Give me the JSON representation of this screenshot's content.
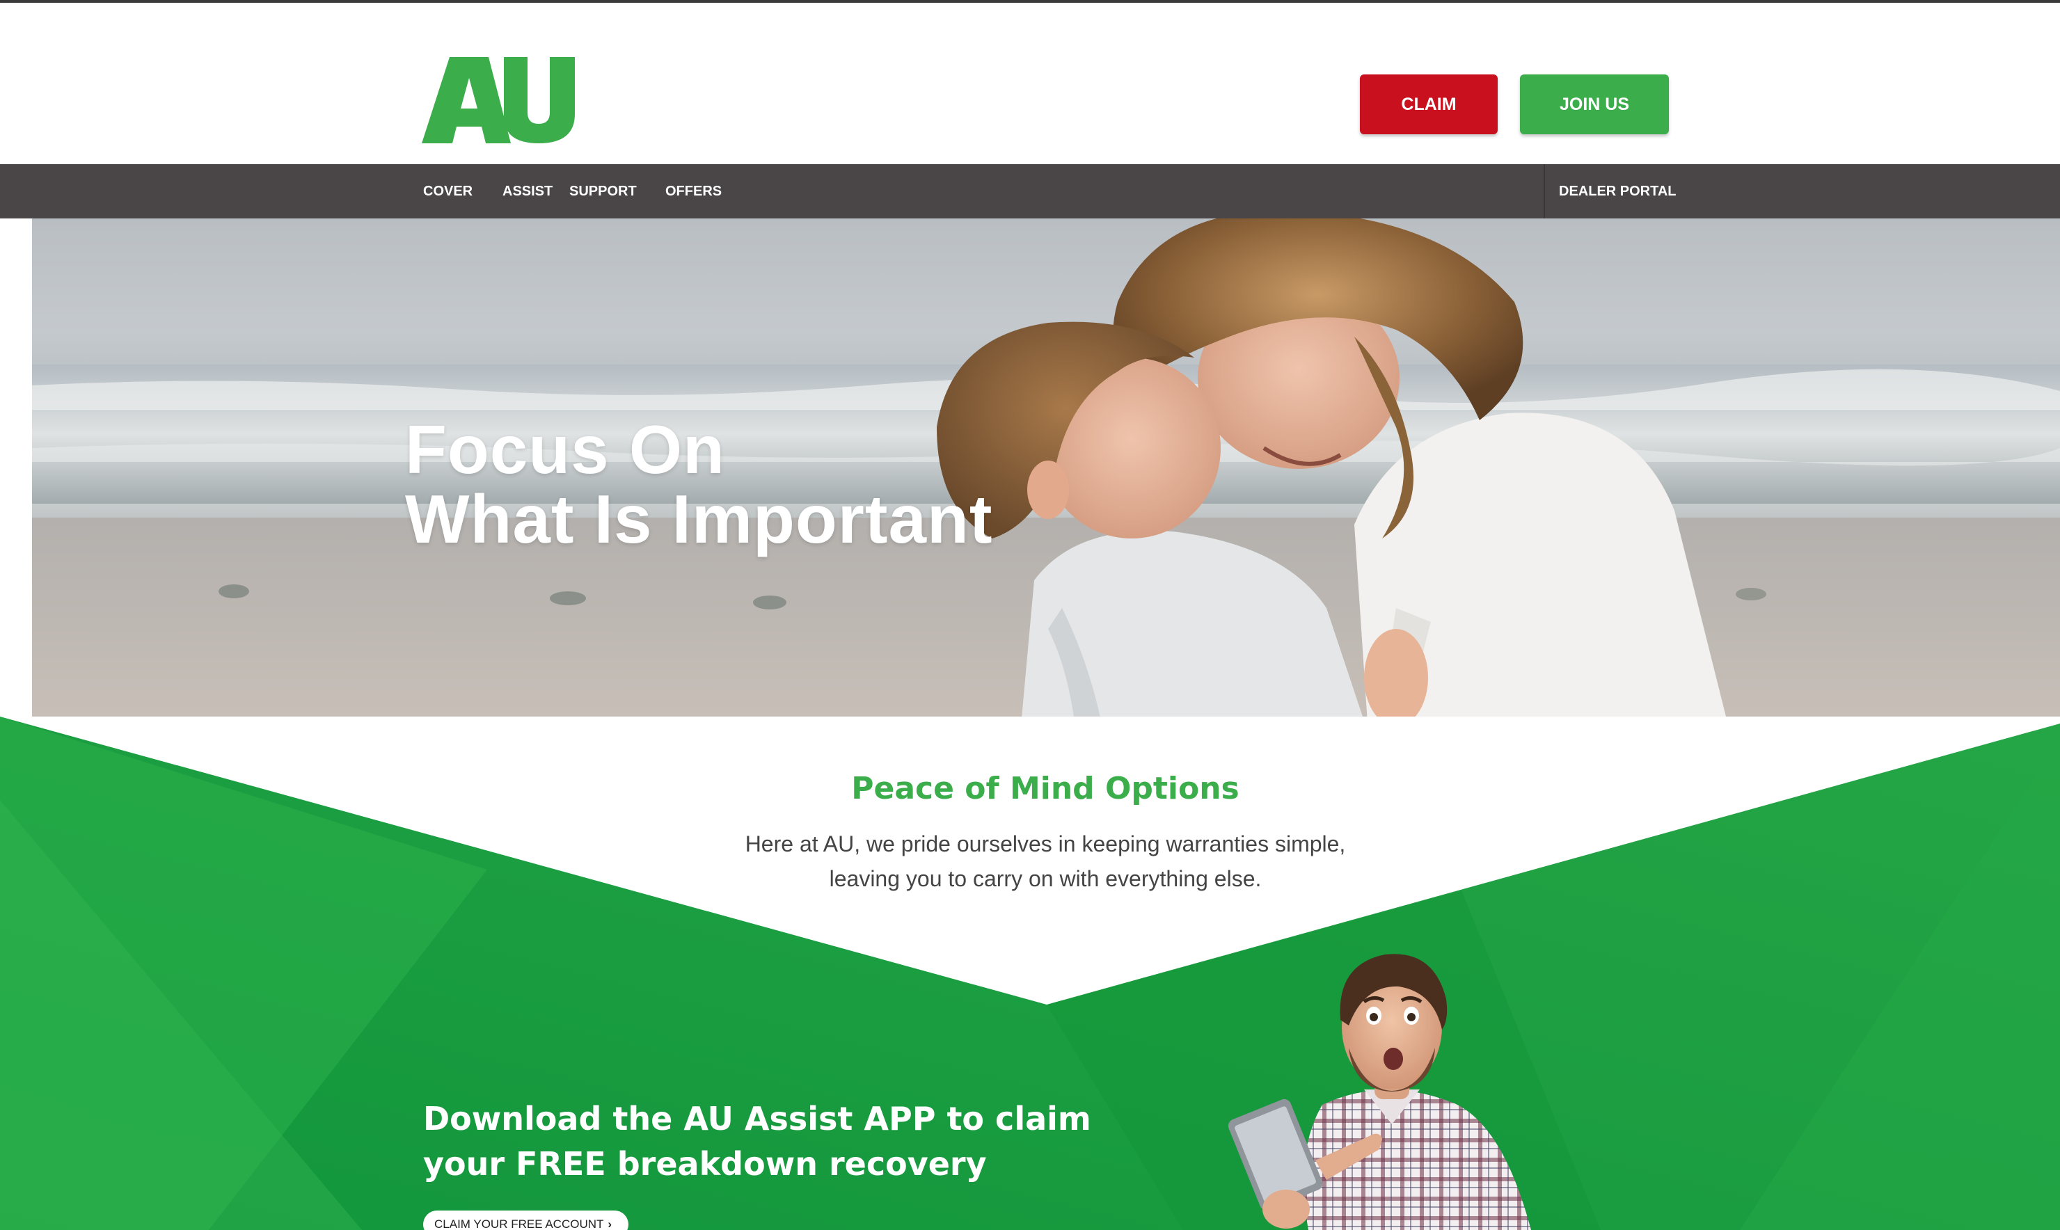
{
  "header": {
    "logo_text": "AU",
    "claim_label": "CLAIM",
    "join_label": "JOIN US"
  },
  "nav": {
    "items": [
      {
        "label": "COVER"
      },
      {
        "label": "ASSIST"
      },
      {
        "label": "SUPPORT"
      },
      {
        "label": "OFFERS"
      }
    ],
    "dealer_portal": "DEALER PORTAL"
  },
  "hero": {
    "line1": "Focus On",
    "line2": "What Is Important"
  },
  "peace": {
    "title": "Peace of Mind Options",
    "line1": "Here at AU, we pride ourselves in keeping warranties simple,",
    "line2": "leaving you to carry on with everything else."
  },
  "app": {
    "line1": "Download the AU Assist APP to claim",
    "line2": "your FREE breakdown recovery",
    "cta_label": "CLAIM YOUR FREE ACCOUNT",
    "cta_chevron": "›"
  },
  "colors": {
    "brand_green": "#3cad4b",
    "deep_green": "#1f9a3f",
    "claim_red": "#c8101e",
    "nav_bg": "#4a4546"
  },
  "icons": {
    "cta_chevron": "chevron-right-icon"
  }
}
